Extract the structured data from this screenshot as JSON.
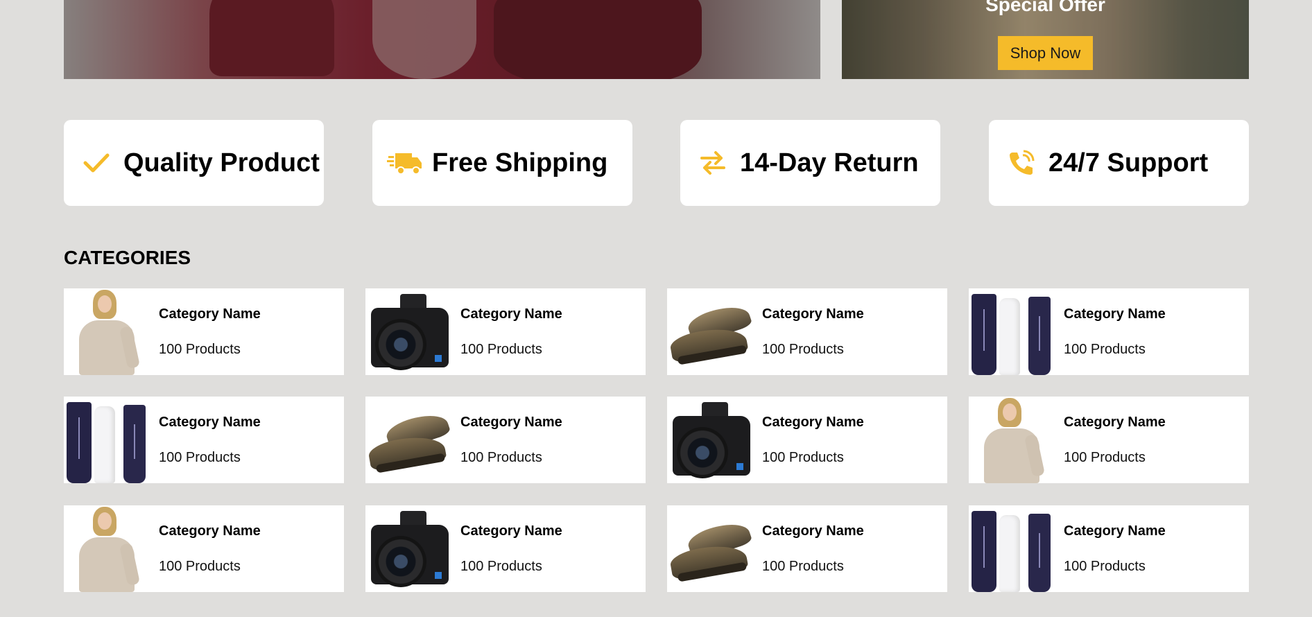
{
  "hero": {
    "offer_title": "Special Offer",
    "shop_button": "Shop Now"
  },
  "features": [
    {
      "icon": "check-icon",
      "label": "Quality Product"
    },
    {
      "icon": "truck-icon",
      "label": "Free Shipping"
    },
    {
      "icon": "exchange-arrows-icon",
      "label": "14-Day Return"
    },
    {
      "icon": "phone-icon",
      "label": "24/7 Support"
    }
  ],
  "categories": {
    "heading": "CATEGORIES",
    "items": [
      {
        "name": "Category Name",
        "count": "100 Products",
        "image": "woman"
      },
      {
        "name": "Category Name",
        "count": "100 Products",
        "image": "camera"
      },
      {
        "name": "Category Name",
        "count": "100 Products",
        "image": "shoes"
      },
      {
        "name": "Category Name",
        "count": "100 Products",
        "image": "tubes"
      },
      {
        "name": "Category Name",
        "count": "100 Products",
        "image": "tubes"
      },
      {
        "name": "Category Name",
        "count": "100 Products",
        "image": "shoes"
      },
      {
        "name": "Category Name",
        "count": "100 Products",
        "image": "camera"
      },
      {
        "name": "Category Name",
        "count": "100 Products",
        "image": "woman"
      },
      {
        "name": "Category Name",
        "count": "100 Products",
        "image": "woman"
      },
      {
        "name": "Category Name",
        "count": "100 Products",
        "image": "camera"
      },
      {
        "name": "Category Name",
        "count": "100 Products",
        "image": "shoes"
      },
      {
        "name": "Category Name",
        "count": "100 Products",
        "image": "tubes"
      }
    ]
  },
  "colors": {
    "background": "#dfdedc",
    "accent": "#f5bb2a",
    "card": "#ffffff"
  }
}
